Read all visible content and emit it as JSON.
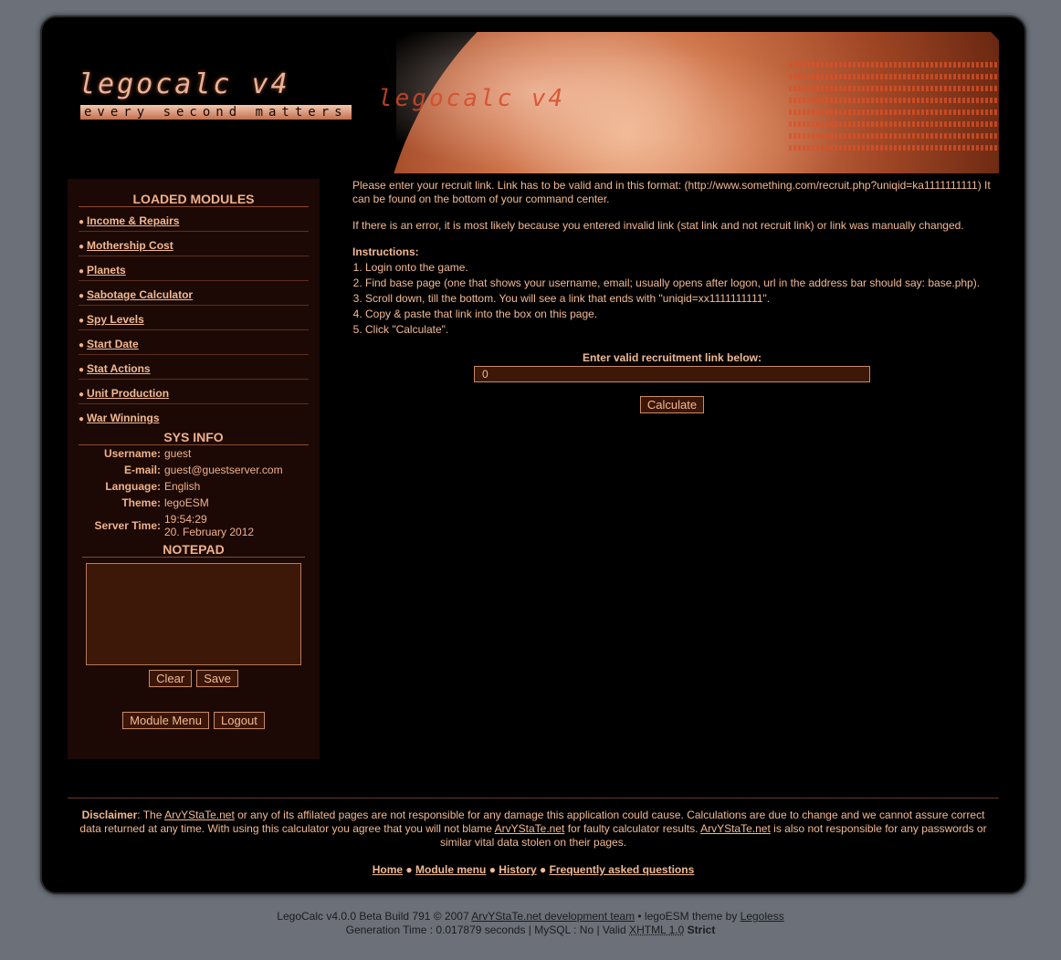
{
  "header": {
    "logo": "legocalc v4",
    "tagline": "every second matters",
    "ghost_logo": "legocalc v4"
  },
  "sidebar": {
    "modules_title": "LOADED MODULES",
    "modules": [
      {
        "label": "Income & Repairs"
      },
      {
        "label": "Mothership Cost"
      },
      {
        "label": "Planets"
      },
      {
        "label": "Sabotage Calculator"
      },
      {
        "label": "Spy Levels"
      },
      {
        "label": "Start Date"
      },
      {
        "label": "Stat Actions"
      },
      {
        "label": "Unit Production"
      },
      {
        "label": "War Winnings"
      }
    ],
    "sysinfo_title": "SYS INFO",
    "sysinfo": {
      "username_label": "Username:",
      "username": "guest",
      "email_label": "E-mail:",
      "email": "guest@guestserver.com",
      "language_label": "Language:",
      "language": "English",
      "theme_label": "Theme:",
      "theme": "legoESM",
      "time_label": "Server Time:",
      "time": "19:54:29",
      "date": "20. February 2012"
    },
    "notepad_title": "NOTEPAD",
    "notepad_value": "",
    "clear_label": "Clear",
    "save_label": "Save",
    "module_menu_label": "Module Menu",
    "logout_label": "Logout"
  },
  "main": {
    "intro": "Please enter your recruit link. Link has to be valid and in this format: (http://www.something.com/recruit.php?uniqid=ka1111111111) It can be found on the bottom of your command center.",
    "error_note": "If there is an error, it is most likely because you entered invalid link (stat link and not recruit link) or link was manually changed.",
    "instructions_title": "Instructions:",
    "steps": [
      "Login onto the game.",
      "Find base page (one that shows your username, email; usually opens after logon, url in the address bar should say: base.php).",
      "Scroll down, till the bottom. You will see a link that ends with \"uniqid=xx1111111111\".",
      "Copy & paste that link into the box on this page.",
      "Click \"Calculate\"."
    ],
    "input_label": "Enter valid recruitment link below:",
    "input_value": "0",
    "calculate_label": "Calculate"
  },
  "footer": {
    "disclaimer_label": "Disclaimer",
    "disclaimer_p1": ": The ",
    "site_link": "ArvYStaTe.net",
    "disclaimer_p2": " or any of its affilated pages are not responsible for any damage this application could cause. Calculations are due to change and we cannot assure correct data returned at any time. With using this calculator you agree that you will not blame ",
    "disclaimer_p3": " for faulty calculator results. ",
    "disclaimer_p4": " is also not responsible for any passwords or similar vital data stolen on their pages.",
    "nav": [
      "Home",
      "Module menu",
      "History",
      "Frequently asked questions"
    ],
    "nav_sep": "●"
  },
  "credits": {
    "line1_a": "LegoCalc v4.0.0 Beta Build 791 © 2007 ",
    "dev_team": "ArvYStaTe.net development team",
    "line1_b": " • legoESM theme by ",
    "theme_author": "Legoless",
    "line2_a": "Generation Time : 0.017879 seconds | MySQL : No | Valid ",
    "xhtml": "XHTML 1.0",
    "strict": "Strict"
  },
  "colors": {
    "accent": "#f2b993",
    "sidebar_bg": "#1c0905",
    "page_bg": "#6b7079"
  }
}
